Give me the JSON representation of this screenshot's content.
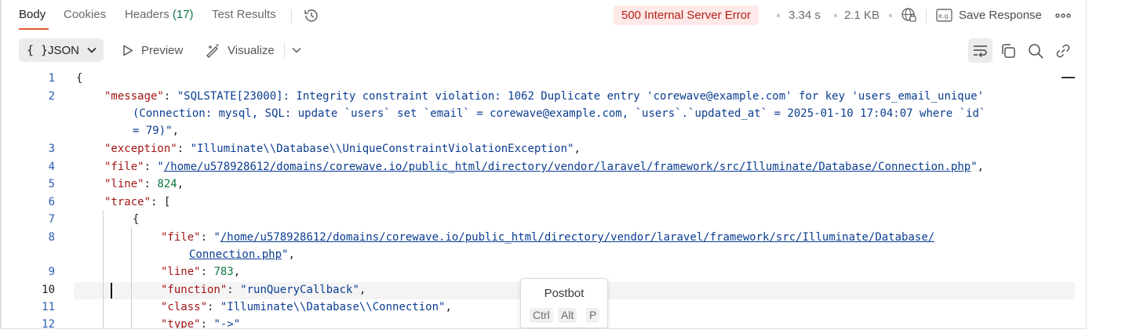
{
  "tabs": [
    {
      "label": "Body"
    },
    {
      "label": "Cookies"
    },
    {
      "label": "Headers",
      "count": "(17)"
    },
    {
      "label": "Test Results"
    }
  ],
  "response": {
    "status": "500 Internal Server Error",
    "time": "3.34 s",
    "size": "2.1 KB",
    "save_label": "Save Response"
  },
  "toolbar": {
    "format_braces": "{ }",
    "format_label": "JSON",
    "preview_label": "Preview",
    "visualize_label": "Visualize"
  },
  "editor": {
    "current_line": 10,
    "lines": [
      {
        "n": "1",
        "tokens": [
          {
            "t": "p",
            "v": "{"
          }
        ]
      },
      {
        "n": "2",
        "tokens": [
          {
            "t": "k",
            "v": "\"message\""
          },
          {
            "t": "p",
            "v": ": "
          },
          {
            "t": "s",
            "v": "\"SQLSTATE[23000]: Integrity constraint violation: 1062 Duplicate entry 'corewave@example.com' for key 'users_email_unique'"
          }
        ]
      },
      {
        "n": "",
        "tokens": [
          {
            "t": "s",
            "v": "(Connection: mysql, SQL: update `users` set `email` = corewave@example.com, `users`.`updated_at` = 2025-01-10 17:04:07 where `id`"
          }
        ]
      },
      {
        "n": "",
        "tokens": [
          {
            "t": "s",
            "v": "= 79)\""
          },
          {
            "t": "p",
            "v": ","
          }
        ]
      },
      {
        "n": "3",
        "tokens": [
          {
            "t": "k",
            "v": "\"exception\""
          },
          {
            "t": "p",
            "v": ": "
          },
          {
            "t": "s",
            "v": "\"Illuminate\\\\Database\\\\UniqueConstraintViolationException\""
          },
          {
            "t": "p",
            "v": ","
          }
        ]
      },
      {
        "n": "4",
        "tokens": [
          {
            "t": "k",
            "v": "\"file\""
          },
          {
            "t": "p",
            "v": ": "
          },
          {
            "t": "s",
            "v": "\""
          },
          {
            "t": "u",
            "v": "/home/u578928612/domains/corewave.io/public_html/directory/vendor/laravel/framework/src/Illuminate/Database/Connection.php"
          },
          {
            "t": "s",
            "v": "\""
          },
          {
            "t": "p",
            "v": ","
          }
        ]
      },
      {
        "n": "5",
        "tokens": [
          {
            "t": "k",
            "v": "\"line\""
          },
          {
            "t": "p",
            "v": ": "
          },
          {
            "t": "n",
            "v": "824"
          },
          {
            "t": "p",
            "v": ","
          }
        ]
      },
      {
        "n": "6",
        "tokens": [
          {
            "t": "k",
            "v": "\"trace\""
          },
          {
            "t": "p",
            "v": ": ["
          }
        ]
      },
      {
        "n": "7",
        "tokens": [
          {
            "t": "p",
            "v": "{"
          }
        ]
      },
      {
        "n": "8",
        "tokens": [
          {
            "t": "k",
            "v": "\"file\""
          },
          {
            "t": "p",
            "v": ": "
          },
          {
            "t": "s",
            "v": "\""
          },
          {
            "t": "u",
            "v": "/home/u578928612/domains/corewave.io/public_html/directory/vendor/laravel/framework/src/Illuminate/Database/"
          }
        ]
      },
      {
        "n": "",
        "tokens": [
          {
            "t": "u",
            "v": "Connection.php"
          },
          {
            "t": "s",
            "v": "\""
          },
          {
            "t": "p",
            "v": ","
          }
        ]
      },
      {
        "n": "9",
        "tokens": [
          {
            "t": "k",
            "v": "\"line\""
          },
          {
            "t": "p",
            "v": ": "
          },
          {
            "t": "n",
            "v": "783"
          },
          {
            "t": "p",
            "v": ","
          }
        ]
      },
      {
        "n": "10",
        "tokens": [
          {
            "t": "k",
            "v": "\"function\""
          },
          {
            "t": "p",
            "v": ": "
          },
          {
            "t": "s",
            "v": "\"runQueryCallback\""
          },
          {
            "t": "p",
            "v": ","
          }
        ]
      },
      {
        "n": "11",
        "tokens": [
          {
            "t": "k",
            "v": "\"class\""
          },
          {
            "t": "p",
            "v": ": "
          },
          {
            "t": "s",
            "v": "\"Illuminate\\\\Database\\\\Connection\""
          },
          {
            "t": "p",
            "v": ","
          }
        ]
      },
      {
        "n": "12",
        "tokens": [
          {
            "t": "k",
            "v": "\"type\""
          },
          {
            "t": "p",
            "v": ": "
          },
          {
            "t": "s",
            "v": "\"->\""
          }
        ]
      }
    ]
  },
  "postbot": {
    "title": "Postbot",
    "keys": [
      "Ctrl",
      "Alt",
      "P"
    ]
  },
  "icons": {
    "history": "history-icon",
    "network": "globe-lock-icon",
    "example": "example-icon",
    "more": "more-dots-icon",
    "wrap": "wrap-lines-icon",
    "copy": "copy-icon",
    "search": "search-icon",
    "link": "link-icon"
  },
  "colors": {
    "accent": "#e4572e",
    "status_bg": "#fde9e7",
    "status_text": "#b42318",
    "json_key": "#a31515",
    "json_string": "#0b3d91",
    "json_number": "#0c7a43"
  }
}
